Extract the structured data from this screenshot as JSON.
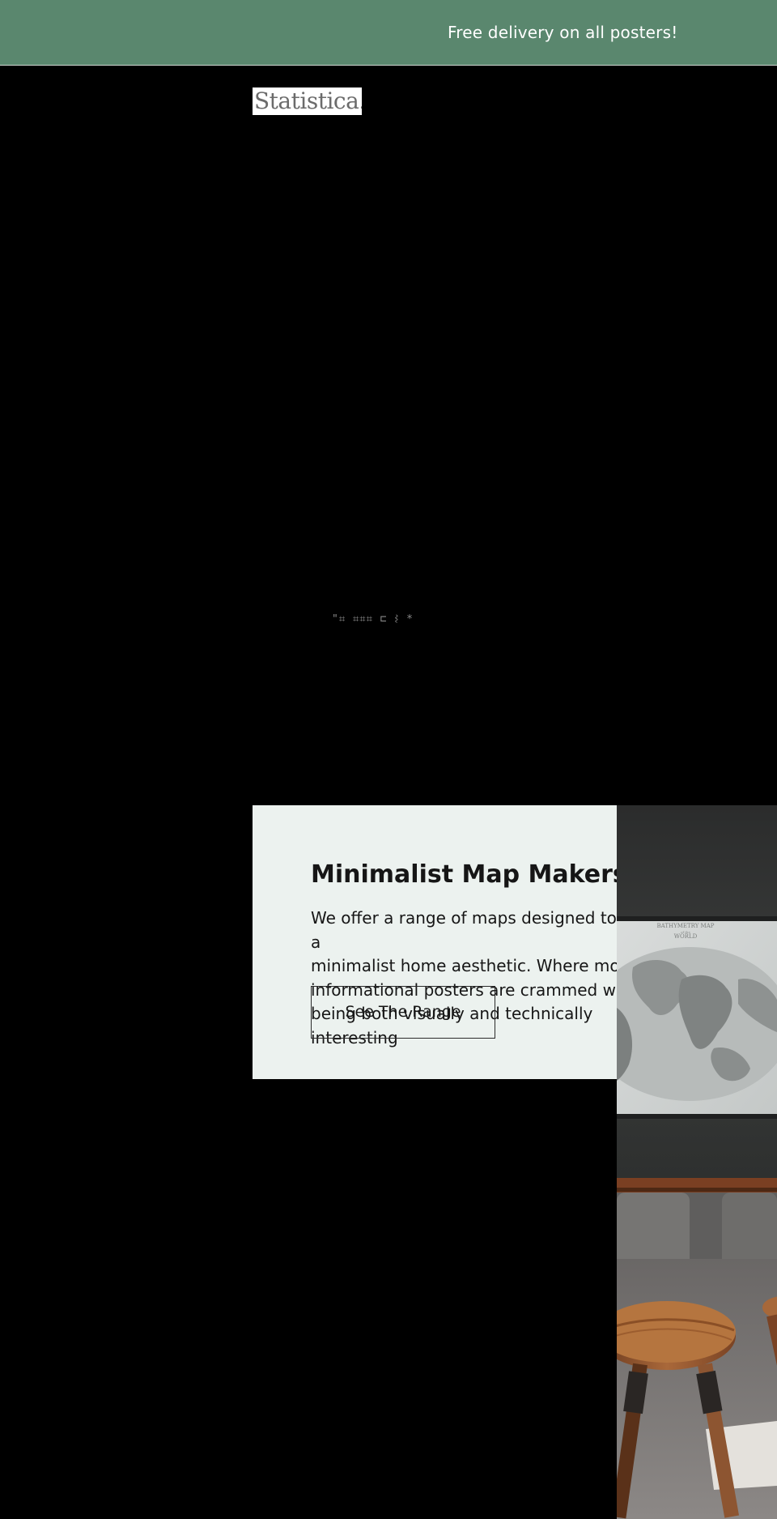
{
  "announcement": {
    "text": "Free delivery on all posters!"
  },
  "header": {
    "logo_text": "Statistica."
  },
  "hero": {
    "glyph_text": "\"⌗ ⌗⌗⌗ ⊏ ⌇ *"
  },
  "promo": {
    "title": "Minimalist Map Makers",
    "body": "We offer a range of maps designed to fit a\nminimalist home aesthetic. Where most\ninformational posters are crammed with\nbeing both visually and technically interesting",
    "button_label": "See The Range"
  },
  "map_poster": {
    "title_line1": "BATHYMETRY MAP",
    "title_line2": "of the",
    "title_line3": "WORLD"
  },
  "colors": {
    "announcement_bg": "#5a876e",
    "promo_panel_bg": "#ecf2ef",
    "page_bg": "#000000"
  }
}
